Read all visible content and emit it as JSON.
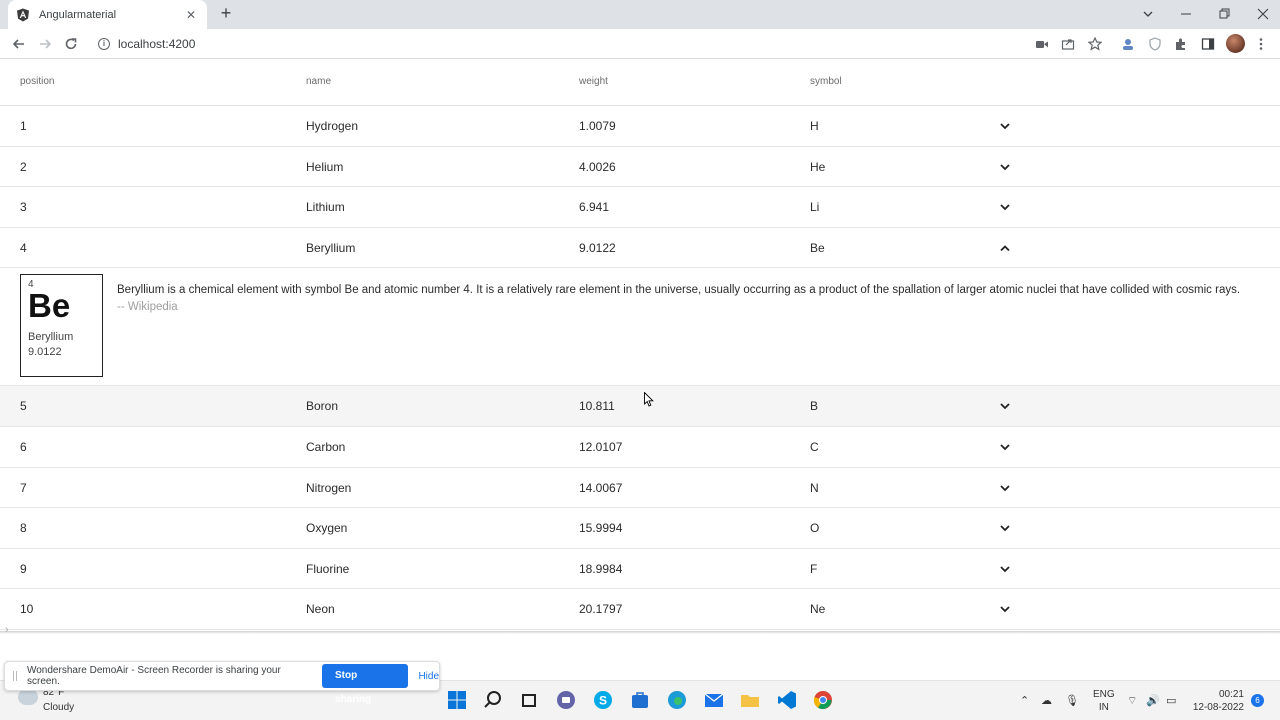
{
  "browser": {
    "tab_title": "Angularmaterial",
    "url": "localhost:4200"
  },
  "table": {
    "headers": [
      "position",
      "name",
      "weight",
      "symbol"
    ],
    "rows_before": [
      {
        "position": "1",
        "name": "Hydrogen",
        "weight": "1.0079",
        "symbol": "H"
      },
      {
        "position": "2",
        "name": "Helium",
        "weight": "4.0026",
        "symbol": "He"
      },
      {
        "position": "3",
        "name": "Lithium",
        "weight": "6.941",
        "symbol": "Li"
      },
      {
        "position": "4",
        "name": "Beryllium",
        "weight": "9.0122",
        "symbol": "Be"
      }
    ],
    "expanded": {
      "number": "4",
      "symbol": "Be",
      "name": "Beryllium",
      "weight": "9.0122",
      "description": "Beryllium is a chemical element with symbol Be and atomic number 4. It is a relatively rare element in the universe, usually occurring as a product of the spallation of larger atomic nuclei that have collided with cosmic rays.",
      "attribution": "-- Wikipedia"
    },
    "rows_after": [
      {
        "position": "5",
        "name": "Boron",
        "weight": "10.811",
        "symbol": "B"
      },
      {
        "position": "6",
        "name": "Carbon",
        "weight": "12.0107",
        "symbol": "C"
      },
      {
        "position": "7",
        "name": "Nitrogen",
        "weight": "14.0067",
        "symbol": "N"
      },
      {
        "position": "8",
        "name": "Oxygen",
        "weight": "15.9994",
        "symbol": "O"
      },
      {
        "position": "9",
        "name": "Fluorine",
        "weight": "18.9984",
        "symbol": "F"
      },
      {
        "position": "10",
        "name": "Neon",
        "weight": "20.1797",
        "symbol": "Ne"
      }
    ]
  },
  "sharebar": {
    "message": "Wondershare DemoAir - Screen Recorder is sharing your screen.",
    "stop_label": "Stop sharing",
    "hide_label": "Hide"
  },
  "taskbar": {
    "weather_temp": "82°F",
    "weather_condition": "Cloudy",
    "lang_line1": "ENG",
    "lang_line2": "IN",
    "time": "00:21",
    "date": "12-08-2022",
    "notification_count": "6"
  }
}
